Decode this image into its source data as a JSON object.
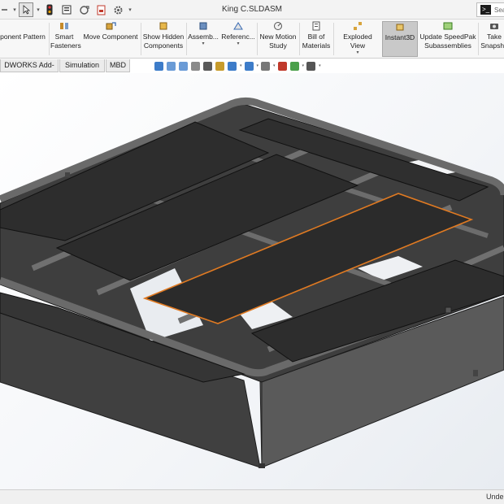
{
  "window": {
    "title": "King C.SLDASM"
  },
  "quick_access": {
    "search_placeholder": "Sea"
  },
  "ribbon": {
    "buttons": [
      {
        "line1": "ponent Pattern",
        "line2": ""
      },
      {
        "line1": "Smart",
        "line2": "Fasteners"
      },
      {
        "line1": "Move Component",
        "line2": ""
      },
      {
        "line1": "Show Hidden",
        "line2": "Components"
      },
      {
        "line1": "Assemb...",
        "line2": ""
      },
      {
        "line1": "Referenc...",
        "line2": ""
      },
      {
        "line1": "New Motion",
        "line2": "Study"
      },
      {
        "line1": "Bill of",
        "line2": "Materials"
      },
      {
        "line1": "Exploded View",
        "line2": ""
      },
      {
        "line1": "Instant3D",
        "line2": ""
      },
      {
        "line1": "Update SpeedPak",
        "line2": "Subassemblies"
      },
      {
        "line1": "Take",
        "line2": "Snapsho"
      }
    ]
  },
  "tabs": [
    "DWORKS Add-Ins",
    "Simulation",
    "MBD"
  ],
  "status": {
    "text": "Unde"
  },
  "colors": {
    "titlebar": "#f3f3f3",
    "ribbon_bg": "#f7f7f7",
    "active_button": "#c9c9c9",
    "frame": "#4e4e4e",
    "panel": "#2d2d2d",
    "selection_edge": "#e07a22"
  },
  "icons": [
    "undo-icon",
    "select-arrow-icon",
    "traffic-light-icon",
    "file-properties-icon",
    "rebuild-icon",
    "print-icon",
    "options-gear-icon",
    "terminal-icon"
  ]
}
